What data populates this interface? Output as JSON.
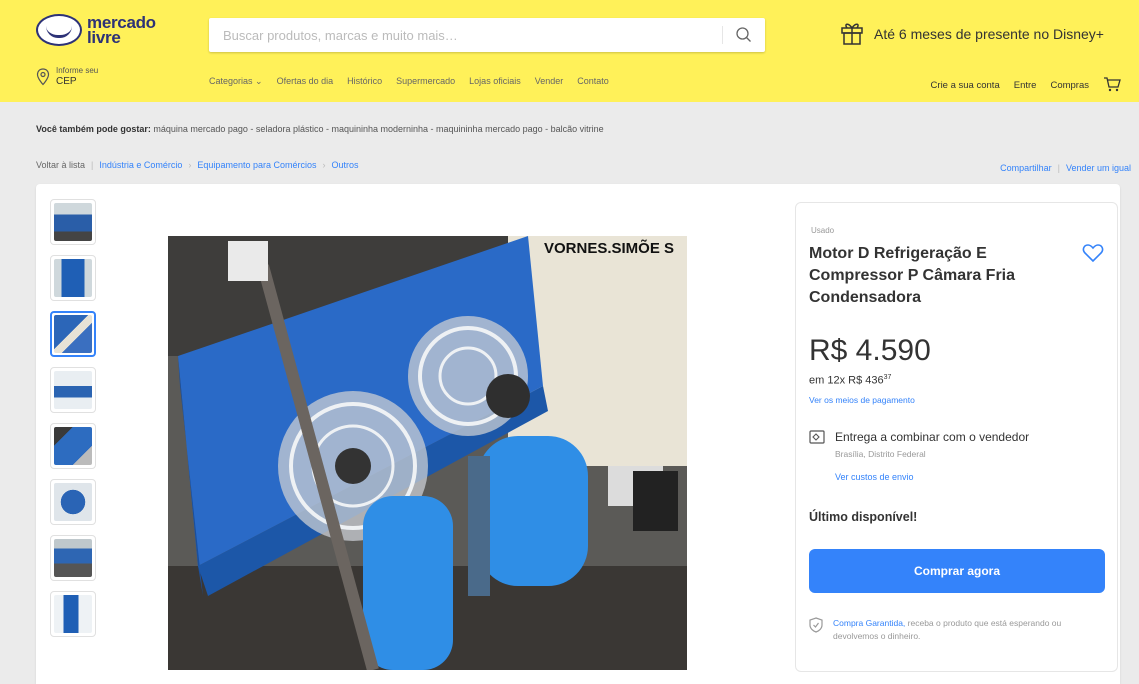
{
  "header": {
    "logo_line1": "mercado",
    "logo_line2": "livre",
    "search_placeholder": "Buscar produtos, marcas e muito mais…",
    "promo": "Até 6 meses de presente no Disney+",
    "location_small": "Informe seu",
    "location_big": "CEP",
    "nav": [
      "Categorias ⌄",
      "Ofertas do dia",
      "Histórico",
      "Supermercado",
      "Lojas oficiais",
      "Vender",
      "Contato"
    ],
    "user_nav": [
      "Crie a sua conta",
      "Entre",
      "Compras"
    ]
  },
  "suggestions": {
    "label": "Você também pode gostar:",
    "items": "máquina mercado pago - seladora plástico - maquininha moderninha - maquininha mercado pago - balcão vitrine"
  },
  "breadcrumb": {
    "back": "Voltar à lista",
    "items": [
      "Indústria e Comércio",
      "Equipamento para Comércios",
      "Outros"
    ],
    "separator": "›"
  },
  "share": {
    "share": "Compartilhar",
    "sell": "Vender um igual"
  },
  "product": {
    "watermark": "VORNES.SIMÕE S",
    "condition": "Usado",
    "title": "Motor D Refrigeração E Compressor P Câmara Fria Condensadora",
    "price": "R$ 4.590",
    "installments": "em 12x R$ 436",
    "installments_cents": "37",
    "payment_link": "Ver os meios de pagamento",
    "shipping": "Entrega a combinar com o vendedor",
    "shipping_location": "Brasília, Distrito Federal",
    "shipping_link": "Ver custos de envio",
    "stock": "Último disponível!",
    "buy_button": "Comprar agora",
    "guarantee_link": "Compra Garantida,",
    "guarantee_text": " receba o produto que está esperando ou devolvemos o dinheiro."
  },
  "colors": {
    "header_bg": "#fff159",
    "accent": "#3483fa",
    "brand": "#2d3277"
  },
  "thumbnails": {
    "count": 8,
    "active_index": 2
  }
}
